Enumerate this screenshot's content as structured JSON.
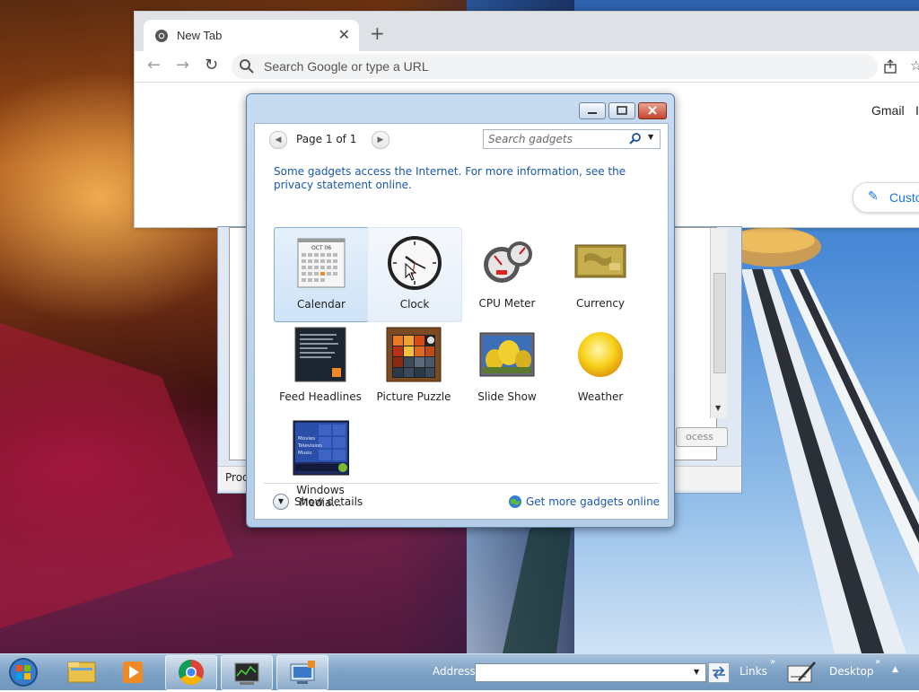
{
  "browser": {
    "tab_title": "New Tab",
    "tab_close": "✕",
    "new_tab": "+",
    "omnibox_placeholder": "Search Google or type a URL",
    "gmail_link": "Gmail",
    "images_link_truncated": "I",
    "customize_label": "Custo"
  },
  "background_window": {
    "button_label": "ocess",
    "status_text": "Prod"
  },
  "gadget_gallery": {
    "pager_text": "Page 1 of 1",
    "search_placeholder": "Search gadgets",
    "notice_text": "Some gadgets access the Internet.  For more information, see the privacy statement online.",
    "gadgets": [
      {
        "label": "Calendar",
        "icon": "calendar-icon",
        "state": "selected"
      },
      {
        "label": "Clock",
        "icon": "clock-icon",
        "state": "hover"
      },
      {
        "label": "CPU Meter",
        "icon": "cpu-meter-icon",
        "state": "normal"
      },
      {
        "label": "Currency",
        "icon": "currency-icon",
        "state": "normal"
      },
      {
        "label": "Feed Headlines",
        "icon": "feed-headlines-icon",
        "state": "normal"
      },
      {
        "label": "Picture Puzzle",
        "icon": "picture-puzzle-icon",
        "state": "normal"
      },
      {
        "label": "Slide Show",
        "icon": "slide-show-icon",
        "state": "normal"
      },
      {
        "label": "Weather",
        "icon": "weather-icon",
        "state": "normal"
      },
      {
        "label": "Windows Media...",
        "icon": "windows-media-icon",
        "state": "normal"
      }
    ],
    "calendar_month": "OCT 06",
    "media_center_lines": [
      "Movies",
      "Television",
      "Music"
    ],
    "show_details": "Show details",
    "get_more_online": "Get more gadgets online"
  },
  "taskbar": {
    "address_label": "Address",
    "address_value": "",
    "links_label": "Links",
    "desktop_label": "Desktop",
    "chevron": "»",
    "pinned": [
      "windows-explorer-icon",
      "windows-media-player-icon",
      "chrome-icon",
      "task-manager-icon",
      "gadget-gallery-icon"
    ]
  },
  "colors": {
    "link_blue": "#1a58a8",
    "chrome_accent": "#1a73e8",
    "taskbar": "#7fa4c8"
  }
}
